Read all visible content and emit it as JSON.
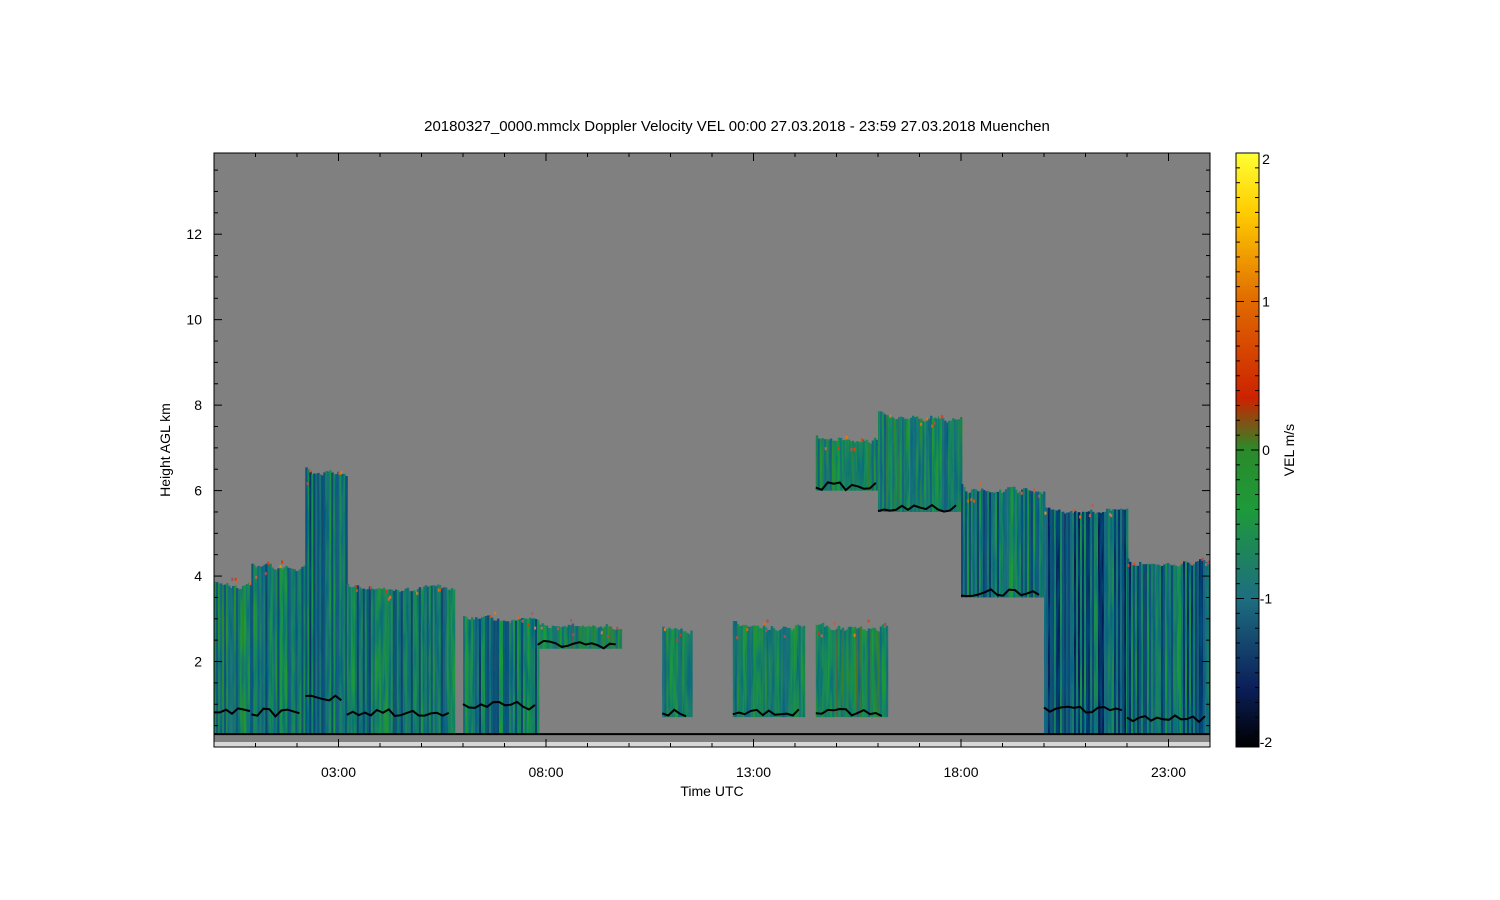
{
  "chart_data": {
    "type": "heatmap",
    "title": "20180327_0000.mmclx Doppler Velocity VEL   00:00 27.03.2018 - 23:59 27.03.2018 Muenchen",
    "xlabel": "Time UTC",
    "ylabel": "Height AGL km",
    "x_range_hours": [
      0,
      24
    ],
    "y_range_km": [
      0,
      13.9
    ],
    "x_ticks": [
      {
        "hour": 3,
        "label": "03:00"
      },
      {
        "hour": 8,
        "label": "08:00"
      },
      {
        "hour": 13,
        "label": "13:00"
      },
      {
        "hour": 18,
        "label": "18:00"
      },
      {
        "hour": 23,
        "label": "23:00"
      }
    ],
    "y_ticks": [
      {
        "value": 2,
        "label": "2"
      },
      {
        "value": 4,
        "label": "4"
      },
      {
        "value": 6,
        "label": "6"
      },
      {
        "value": 8,
        "label": "8"
      },
      {
        "value": 10,
        "label": "10"
      },
      {
        "value": 12,
        "label": "12"
      }
    ],
    "colorbar": {
      "label": "VEL m/s",
      "range": [
        -2,
        2
      ],
      "ticks": [
        {
          "value": 2,
          "label": "2"
        },
        {
          "value": 1,
          "label": "1"
        },
        {
          "value": 0,
          "label": "0"
        },
        {
          "value": -1,
          "label": "-1"
        },
        {
          "value": -2,
          "label": "-2"
        }
      ],
      "stops": [
        {
          "value": -2,
          "color": "#000000"
        },
        {
          "value": -1.6,
          "color": "#0b1f5a"
        },
        {
          "value": -1,
          "color": "#1d6e80"
        },
        {
          "value": -0.4,
          "color": "#1e9a3a"
        },
        {
          "value": 0,
          "color": "#2a8a2a"
        },
        {
          "value": 0.35,
          "color": "#cc2200"
        },
        {
          "value": 1,
          "color": "#e06a00"
        },
        {
          "value": 1.6,
          "color": "#ffcc00"
        },
        {
          "value": 2,
          "color": "#ffff33"
        }
      ]
    },
    "background_color": "#808080",
    "cloud_regions": [
      {
        "start_h": 0.0,
        "end_h": 0.9,
        "base_km": 0.3,
        "top_km": 4.0,
        "mean_vel": -0.6
      },
      {
        "start_h": 0.9,
        "end_h": 2.2,
        "base_km": 0.3,
        "top_km": 4.4,
        "mean_vel": -0.8
      },
      {
        "start_h": 2.2,
        "end_h": 3.2,
        "base_km": 0.3,
        "top_km": 6.6,
        "mean_vel": -0.9
      },
      {
        "start_h": 3.2,
        "end_h": 5.8,
        "base_km": 0.3,
        "top_km": 3.9,
        "mean_vel": -0.8
      },
      {
        "start_h": 6.0,
        "end_h": 7.8,
        "base_km": 0.3,
        "top_km": 3.2,
        "mean_vel": -0.9
      },
      {
        "start_h": 7.8,
        "end_h": 9.8,
        "base_km": 2.3,
        "top_km": 3.0,
        "mean_vel": -0.4
      },
      {
        "start_h": 10.8,
        "end_h": 11.5,
        "base_km": 0.7,
        "top_km": 2.9,
        "mean_vel": -0.7
      },
      {
        "start_h": 12.5,
        "end_h": 14.2,
        "base_km": 0.7,
        "top_km": 3.0,
        "mean_vel": -0.6
      },
      {
        "start_h": 14.5,
        "end_h": 16.2,
        "base_km": 0.7,
        "top_km": 3.0,
        "mean_vel": -0.5
      },
      {
        "start_h": 14.5,
        "end_h": 16.0,
        "base_km": 6.0,
        "top_km": 7.4,
        "mean_vel": -0.5
      },
      {
        "start_h": 16.0,
        "end_h": 18.0,
        "base_km": 5.5,
        "top_km": 7.9,
        "mean_vel": -0.5
      },
      {
        "start_h": 18.0,
        "end_h": 20.0,
        "base_km": 3.5,
        "top_km": 6.2,
        "mean_vel": -0.8
      },
      {
        "start_h": 20.0,
        "end_h": 22.0,
        "base_km": 0.3,
        "top_km": 5.7,
        "mean_vel": -1.1
      },
      {
        "start_h": 22.0,
        "end_h": 24.0,
        "base_km": 0.3,
        "top_km": 4.5,
        "mean_vel": -1.0
      }
    ]
  }
}
